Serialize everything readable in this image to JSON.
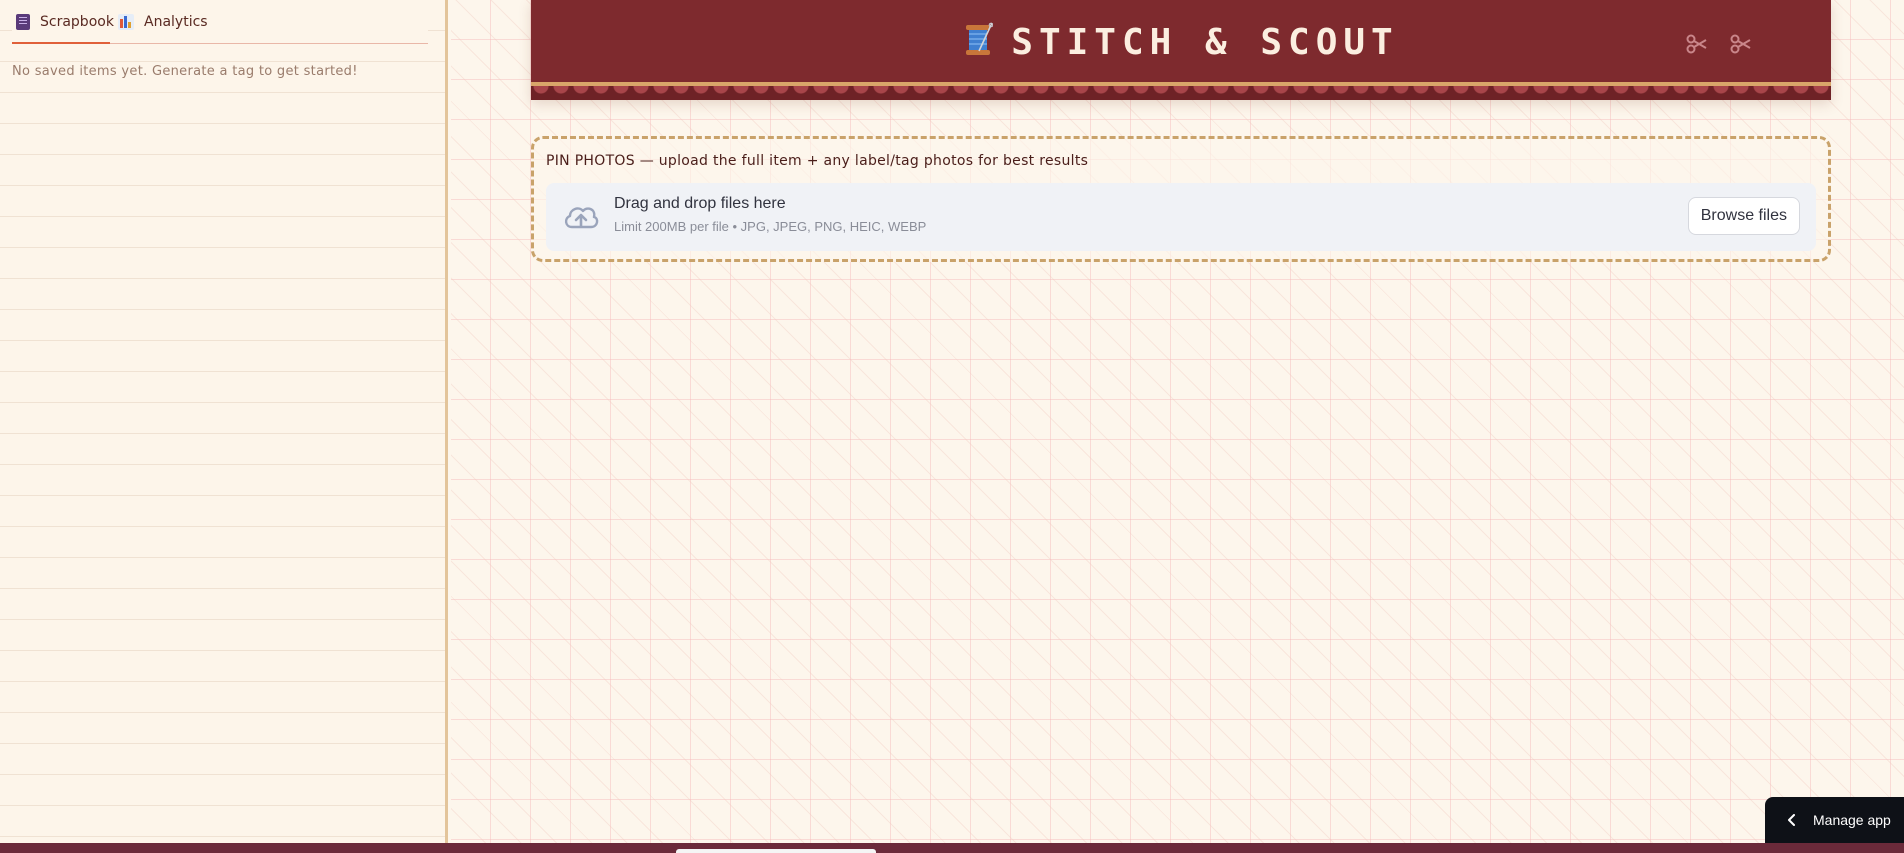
{
  "sidebar": {
    "tabs": [
      {
        "label": "Scrapbook",
        "icon": "book-icon",
        "active": true
      },
      {
        "label": "Analytics",
        "icon": "bar-chart-icon",
        "active": false
      }
    ],
    "empty_message": "No saved items yet. Generate a tag to get started!"
  },
  "header": {
    "title": "STITCH & SCOUT",
    "icon": "thread-spool-icon",
    "decorations": [
      "scissors-icon",
      "scissors-icon"
    ]
  },
  "upload": {
    "label": "PIN PHOTOS — upload the full item + any label/tag photos for best results",
    "drop_title": "Drag and drop files here",
    "limit_text": "Limit 200MB per file • JPG, JPEG, PNG, HEIC, WEBP",
    "browse_label": "Browse files"
  },
  "manage_app": {
    "label": "Manage app"
  },
  "colors": {
    "header_bg": "#7e2a2e",
    "accent": "#e0603a",
    "dash_border": "#c9a26a"
  }
}
